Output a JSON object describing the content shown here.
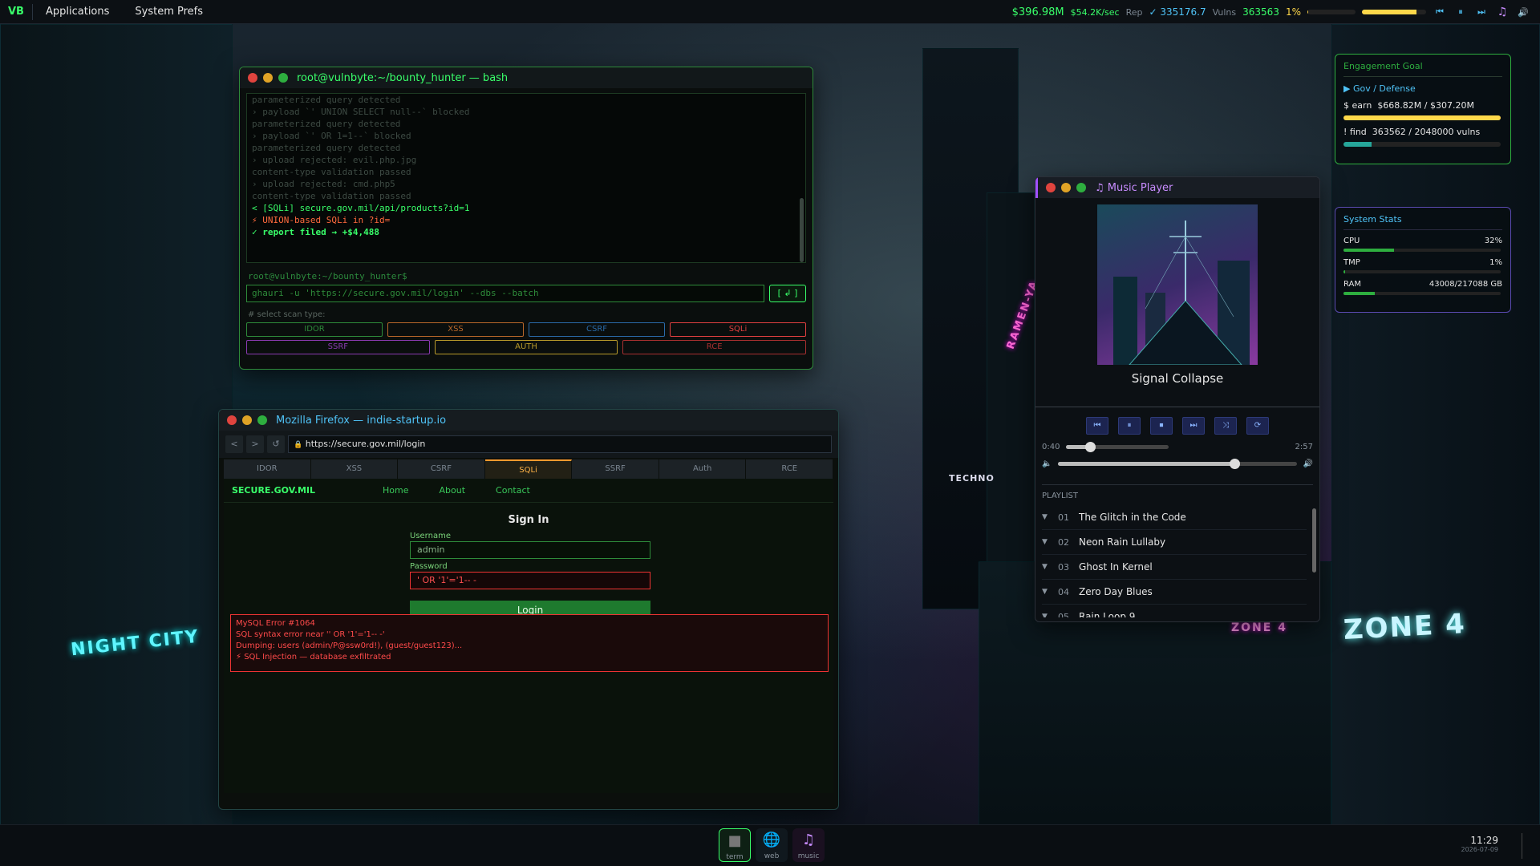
{
  "topbar": {
    "logo": "VB",
    "menu": [
      "Applications",
      "System Prefs"
    ],
    "money": "$396.98M",
    "rate": "$54.2K/sec",
    "rep_label": "Rep",
    "rep_value": "✓ 335176.7",
    "vulns_label": "Vulns",
    "vulns_value": "363563",
    "pct": "1%",
    "level_progress": 0.01,
    "volume_level": 0.85
  },
  "wallpaper": {
    "signs": [
      "NIGHT CITY",
      "ZONE 4",
      "TECHNO",
      "RAMEN-YA",
      "ZONE 4"
    ]
  },
  "terminal": {
    "title": "root@vulnbyte:~/bounty_hunter — bash",
    "log": [
      {
        "t": "parameterized query detected",
        "c": "old"
      },
      {
        "t": "› payload `' UNION SELECT null--` blocked",
        "c": "old"
      },
      {
        "t": "  parameterized query detected",
        "c": "old"
      },
      {
        "t": "› payload `' OR 1=1--` blocked",
        "c": "old"
      },
      {
        "t": "  parameterized query detected",
        "c": "old"
      },
      {
        "t": "› upload rejected: evil.php.jpg",
        "c": "old"
      },
      {
        "t": "  content-type validation passed",
        "c": "old"
      },
      {
        "t": "› upload rejected: cmd.php5",
        "c": "old"
      },
      {
        "t": "  content-type validation passed",
        "c": "old"
      },
      {
        "t": "< [SQLi]  secure.gov.mil/api/products?id=1",
        "c": "hi"
      },
      {
        "t": "  ⚡ UNION-based SQLi in ?id=",
        "c": "cur"
      },
      {
        "t": "  ✓ report filed → +$4,488",
        "c": "ok"
      }
    ],
    "prompt": "root@vulnbyte:~/bounty_hunter$",
    "command": "ghauri -u 'https://secure.gov.mil/login' --dbs --batch",
    "run_label": "[ ↲ ]",
    "scan_label": "# select scan type:",
    "scan_row1": [
      {
        "label": "IDOR",
        "color": "#2e8b3a"
      },
      {
        "label": "XSS",
        "color": "#b8672a"
      },
      {
        "label": "CSRF",
        "color": "#2a6aa8"
      },
      {
        "label": "SQLi",
        "color": "#e04040"
      }
    ],
    "scan_row2": [
      {
        "label": "SSRF",
        "color": "#8a3ab0"
      },
      {
        "label": "AUTH",
        "color": "#b89a2a"
      },
      {
        "label": "RCE",
        "color": "#a83030"
      }
    ]
  },
  "firefox": {
    "title": "Mozilla Firefox — indie-startup.io",
    "nav": [
      "<",
      ">",
      "↺"
    ],
    "url": "https://secure.gov.mil/login",
    "tabs": [
      "IDOR",
      "XSS",
      "CSRF",
      "SQLi",
      "SSRF",
      "Auth",
      "RCE"
    ],
    "active_tab": "SQLi",
    "site": {
      "brand": "SECURE.GOV.MIL",
      "links": [
        "Home",
        "About",
        "Contact"
      ],
      "heading": "Sign In",
      "user_label": "Username",
      "user_value": "admin",
      "pass_label": "Password",
      "pass_value": "' OR '1'='1-- -",
      "login": "Login"
    },
    "error": [
      "MySQL Error #1064",
      "SQL syntax error near '' OR '1'='1-- -'",
      "Dumping: users (admin/P@ssw0rd!), (guest/guest123)...",
      "⚡ SQL Injection — database exfiltrated"
    ]
  },
  "music": {
    "title": "♫  Music Player",
    "song": "Signal Collapse",
    "elapsed": "0:40",
    "duration": "2:57",
    "controls": [
      "⏮",
      "⏸",
      "⏹",
      "⏭",
      "⤨",
      "⟳"
    ],
    "progress_fraction": 0.23,
    "volume_level": 0.74,
    "playlist_label": "PLAYLIST",
    "playlist": [
      {
        "n": "01",
        "t": "The Glitch in the Code"
      },
      {
        "n": "02",
        "t": "Neon Rain Lullaby"
      },
      {
        "n": "03",
        "t": "Ghost In Kernel"
      },
      {
        "n": "04",
        "t": "Zero Day Blues"
      },
      {
        "n": "05",
        "t": "Rain Loop 9"
      }
    ]
  },
  "goal": {
    "title": "Engagement Goal",
    "target": "▶ Gov / Defense",
    "earn_prefix": "$ earn",
    "earn_value": "$668.82M / $307.20M",
    "earn_fraction": 1.0,
    "find_prefix": "! find",
    "find_value": "363562 / 2048000 vulns",
    "find_fraction": 0.18
  },
  "sys": {
    "title": "System Stats",
    "rows": [
      {
        "k": "CPU",
        "v": "32%",
        "f": 0.32,
        "c": "#2eae3f"
      },
      {
        "k": "TMP",
        "v": "1%",
        "f": 0.01,
        "c": "#2eae3f"
      },
      {
        "k": "RAM",
        "v": "43008/217088 GB",
        "f": 0.2,
        "c": "#2eae3f"
      }
    ]
  },
  "dock": {
    "items": [
      {
        "icon": "■",
        "label": "term"
      },
      {
        "icon": "🌐",
        "label": "web"
      },
      {
        "icon": "♫",
        "label": "music"
      }
    ],
    "time": "11:29",
    "date": "2026-07-09"
  }
}
